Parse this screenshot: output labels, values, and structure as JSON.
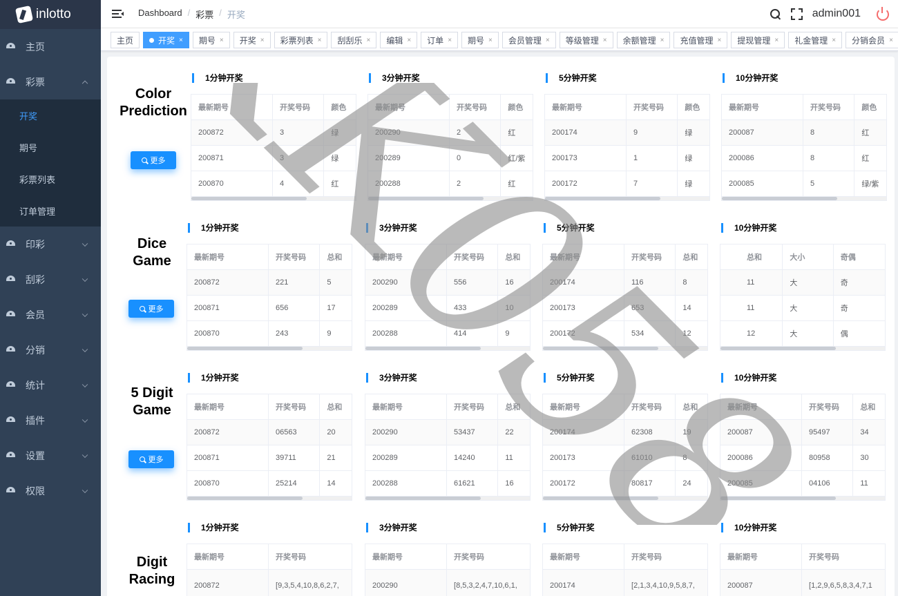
{
  "app": {
    "name": "inlotto"
  },
  "sidebar": {
    "items": [
      {
        "label": "主页"
      },
      {
        "label": "彩票",
        "expanded": true,
        "children": [
          {
            "label": "开奖",
            "active": true
          },
          {
            "label": "期号"
          },
          {
            "label": "彩票列表"
          },
          {
            "label": "订单管理"
          }
        ]
      },
      {
        "label": "印彩"
      },
      {
        "label": "刮彩"
      },
      {
        "label": "会员"
      },
      {
        "label": "分销"
      },
      {
        "label": "统计"
      },
      {
        "label": "插件"
      },
      {
        "label": "设置"
      },
      {
        "label": "权限"
      }
    ]
  },
  "navbar": {
    "breadcrumb": [
      "Dashboard",
      "彩票",
      "开奖"
    ],
    "separator": "/",
    "username": "admin001"
  },
  "tags": [
    {
      "label": "主页",
      "closable": false
    },
    {
      "label": "开奖",
      "closable": true,
      "active": true
    },
    {
      "label": "期号",
      "closable": true
    },
    {
      "label": "开奖",
      "closable": true
    },
    {
      "label": "彩票列表",
      "closable": true
    },
    {
      "label": "刮刮乐",
      "closable": true
    },
    {
      "label": "编辑",
      "closable": true
    },
    {
      "label": "订单",
      "closable": true
    },
    {
      "label": "期号",
      "closable": true
    },
    {
      "label": "会员管理",
      "closable": true
    },
    {
      "label": "等级管理",
      "closable": true
    },
    {
      "label": "余额管理",
      "closable": true
    },
    {
      "label": "充值管理",
      "closable": true
    },
    {
      "label": "提现管理",
      "closable": true
    },
    {
      "label": "礼金管理",
      "closable": true
    },
    {
      "label": "分销会员",
      "closable": true
    }
  ],
  "close_glyph": "×",
  "more_label": "更多",
  "games": [
    {
      "title_lines": [
        "Color",
        "Prediction"
      ],
      "blocks": [
        {
          "title": "1分钟开奖",
          "headers": [
            "最新期号",
            "开奖号码",
            "颜色"
          ],
          "rows": [
            [
              "200872",
              "3",
              "绿"
            ],
            [
              "200871",
              "3",
              "绿"
            ],
            [
              "200870",
              "4",
              "红"
            ]
          ]
        },
        {
          "title": "3分钟开奖",
          "headers": [
            "最新期号",
            "开奖号码",
            "颜色"
          ],
          "rows": [
            [
              "200290",
              "2",
              "红"
            ],
            [
              "200289",
              "0",
              "红/紫"
            ],
            [
              "200288",
              "2",
              "红"
            ]
          ]
        },
        {
          "title": "5分钟开奖",
          "headers": [
            "最新期号",
            "开奖号码",
            "颜色"
          ],
          "rows": [
            [
              "200174",
              "9",
              "绿"
            ],
            [
              "200173",
              "1",
              "绿"
            ],
            [
              "200172",
              "7",
              "绿"
            ]
          ]
        },
        {
          "title": "10分钟开奖",
          "headers": [
            "最新期号",
            "开奖号码",
            "颜色"
          ],
          "rows": [
            [
              "200087",
              "8",
              "红"
            ],
            [
              "200086",
              "8",
              "红"
            ],
            [
              "200085",
              "5",
              "绿/紫"
            ]
          ]
        }
      ]
    },
    {
      "title_lines": [
        "Dice",
        "Game"
      ],
      "blocks": [
        {
          "title": "1分钟开奖",
          "headers": [
            "最新期号",
            "开奖号码",
            "总和"
          ],
          "rows": [
            [
              "200872",
              "221",
              "5"
            ],
            [
              "200871",
              "656",
              "17"
            ],
            [
              "200870",
              "243",
              "9"
            ]
          ]
        },
        {
          "title": "3分钟开奖",
          "headers": [
            "最新期号",
            "开奖号码",
            "总和"
          ],
          "rows": [
            [
              "200290",
              "556",
              "16"
            ],
            [
              "200289",
              "433",
              "10"
            ],
            [
              "200288",
              "414",
              "9"
            ]
          ]
        },
        {
          "title": "5分钟开奖",
          "headers": [
            "最新期号",
            "开奖号码",
            "总和"
          ],
          "rows": [
            [
              "200174",
              "116",
              "8"
            ],
            [
              "200173",
              "653",
              "14"
            ],
            [
              "200172",
              "534",
              "12"
            ]
          ]
        },
        {
          "title": "10分钟开奖",
          "variant": "dice10",
          "headers": [
            "总和",
            "大小",
            "奇偶"
          ],
          "rows": [
            [
              "11",
              "大",
              "奇"
            ],
            [
              "11",
              "大",
              "奇"
            ],
            [
              "12",
              "大",
              "偶"
            ]
          ]
        }
      ]
    },
    {
      "title_lines": [
        "5 Digit",
        "Game"
      ],
      "blocks": [
        {
          "title": "1分钟开奖",
          "headers": [
            "最新期号",
            "开奖号码",
            "总和"
          ],
          "rows": [
            [
              "200872",
              "06563",
              "20"
            ],
            [
              "200871",
              "39711",
              "21"
            ],
            [
              "200870",
              "25214",
              "14"
            ]
          ]
        },
        {
          "title": "3分钟开奖",
          "headers": [
            "最新期号",
            "开奖号码",
            "总和"
          ],
          "rows": [
            [
              "200290",
              "53437",
              "22"
            ],
            [
              "200289",
              "14240",
              "11"
            ],
            [
              "200288",
              "61621",
              "16"
            ]
          ]
        },
        {
          "title": "5分钟开奖",
          "headers": [
            "最新期号",
            "开奖号码",
            "总和"
          ],
          "rows": [
            [
              "200174",
              "62308",
              "19"
            ],
            [
              "200173",
              "61010",
              "8"
            ],
            [
              "200172",
              "80817",
              "24"
            ]
          ]
        },
        {
          "title": "10分钟开奖",
          "headers": [
            "最新期号",
            "开奖号码",
            "总和"
          ],
          "rows": [
            [
              "200087",
              "95497",
              "34"
            ],
            [
              "200086",
              "80958",
              "30"
            ],
            [
              "200085",
              "04106",
              "11"
            ]
          ]
        }
      ]
    },
    {
      "title_lines": [
        "Digit",
        "Racing"
      ],
      "blocks": [
        {
          "title": "1分钟开奖",
          "variant": "racing",
          "headers": [
            "最新期号",
            "开奖号码"
          ],
          "rows": [
            [
              "200872",
              "[9,3,5,4,10,8,6,2,7,"
            ]
          ]
        },
        {
          "title": "3分钟开奖",
          "variant": "racing",
          "headers": [
            "最新期号",
            "开奖号码"
          ],
          "rows": [
            [
              "200290",
              "[8,5,3,2,4,7,10,6,1,"
            ]
          ]
        },
        {
          "title": "5分钟开奖",
          "variant": "racing",
          "headers": [
            "最新期号",
            "开奖号码"
          ],
          "rows": [
            [
              "200174",
              "[2,1,3,4,10,9,5,8,7,"
            ]
          ]
        },
        {
          "title": "10分钟开奖",
          "variant": "racing",
          "headers": [
            "最新期号",
            "开奖号码"
          ],
          "rows": [
            [
              "200087",
              "[1,2,9,6,5,8,3,4,7,1"
            ]
          ]
        }
      ]
    }
  ],
  "watermark": {
    "text": "KK058",
    "color": "#8c8c8c"
  },
  "colors": {
    "sidebar_bg": "#304156",
    "accent": "#1890ff",
    "active_menu": "#409eff",
    "logout": "#f56c6c"
  }
}
